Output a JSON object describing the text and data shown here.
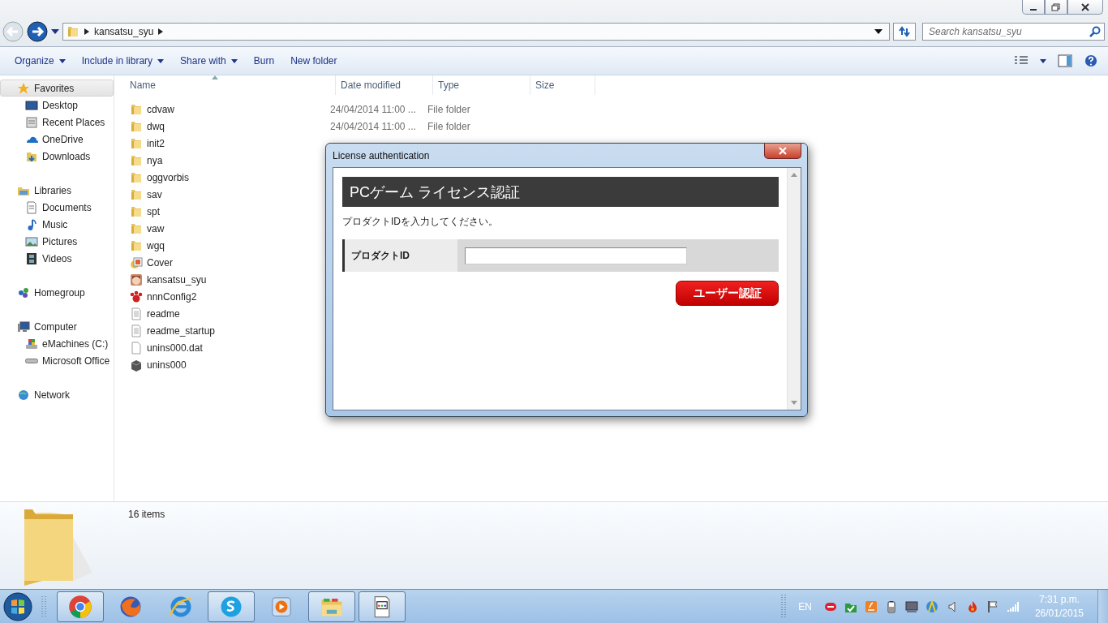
{
  "address": {
    "crumbs": [
      "kansatsu_syu"
    ]
  },
  "search": {
    "placeholder": "Search kansatsu_syu"
  },
  "toolbar": [
    {
      "label": "Organize",
      "has_menu": true
    },
    {
      "label": "Include in library",
      "has_menu": true
    },
    {
      "label": "Share with",
      "has_menu": true
    },
    {
      "label": "Burn",
      "has_menu": false
    },
    {
      "label": "New folder",
      "has_menu": false
    }
  ],
  "nav": [
    {
      "label": "Favorites",
      "kind": "star",
      "selected": true,
      "children": [
        {
          "label": "Desktop",
          "kind": "desktop",
          "selected": false
        },
        {
          "label": "Recent Places",
          "kind": "recent",
          "selected": false
        },
        {
          "label": "OneDrive",
          "kind": "cloud",
          "selected": false
        },
        {
          "label": "Downloads",
          "kind": "downloads",
          "selected": false
        }
      ]
    },
    {
      "label": "Libraries",
      "kind": "library",
      "selected": false,
      "children": [
        {
          "label": "Documents",
          "kind": "document",
          "selected": false
        },
        {
          "label": "Music",
          "kind": "music",
          "selected": false
        },
        {
          "label": "Pictures",
          "kind": "pictures",
          "selected": false
        },
        {
          "label": "Videos",
          "kind": "film",
          "selected": false
        }
      ]
    },
    {
      "label": "Homegroup",
      "kind": "homegroup",
      "selected": false
    },
    {
      "label": "Computer",
      "kind": "computer",
      "selected": false,
      "children": [
        {
          "label": "eMachines (C:)",
          "kind": "drive",
          "selected": false
        },
        {
          "label": "Microsoft Office",
          "kind": "disc",
          "selected": false
        }
      ]
    },
    {
      "label": "Network",
      "kind": "network",
      "selected": false
    }
  ],
  "table": {
    "columns": [
      "Name",
      "Date modified",
      "Type",
      "Size"
    ],
    "rows": [
      {
        "name": "cdvaw",
        "kind": "folder",
        "date": "24/04/2014 11:00 ...",
        "type": "File folder"
      },
      {
        "name": "dwq",
        "kind": "folder",
        "date": "24/04/2014 11:00 ...",
        "type": "File folder"
      },
      {
        "name": "init2",
        "kind": "folder"
      },
      {
        "name": "nya",
        "kind": "folder"
      },
      {
        "name": "oggvorbis",
        "kind": "folder"
      },
      {
        "name": "sav",
        "kind": "folder"
      },
      {
        "name": "spt",
        "kind": "folder"
      },
      {
        "name": "vaw",
        "kind": "folder"
      },
      {
        "name": "wgq",
        "kind": "folder"
      },
      {
        "name": "Cover",
        "kind": "image"
      },
      {
        "name": "kansatsu_syu",
        "kind": "app"
      },
      {
        "name": "nnnConfig2",
        "kind": "paw"
      },
      {
        "name": "readme",
        "kind": "text"
      },
      {
        "name": "readme_startup",
        "kind": "text"
      },
      {
        "name": "unins000.dat",
        "kind": "blank"
      },
      {
        "name": "unins000",
        "kind": "installer"
      }
    ]
  },
  "details": {
    "count": "16 items"
  },
  "dialog": {
    "title": "License authentication",
    "heading": "PCゲーム ライセンス認証",
    "instruction": "プロダクトIDを入力してください。",
    "field_label": "プロダクトID",
    "button": "ユーザー認証"
  },
  "taskbar": {
    "apps": [
      {
        "kind": "chrome",
        "running": true
      },
      {
        "kind": "firefox",
        "running": false
      },
      {
        "kind": "ie",
        "running": false
      },
      {
        "kind": "skype",
        "running": true
      },
      {
        "kind": "media",
        "running": false
      },
      {
        "kind": "explorer",
        "running": true
      },
      {
        "kind": "window",
        "running": true
      }
    ],
    "language": "EN",
    "time": "7:31 p.m.",
    "date": "26/01/2015"
  }
}
